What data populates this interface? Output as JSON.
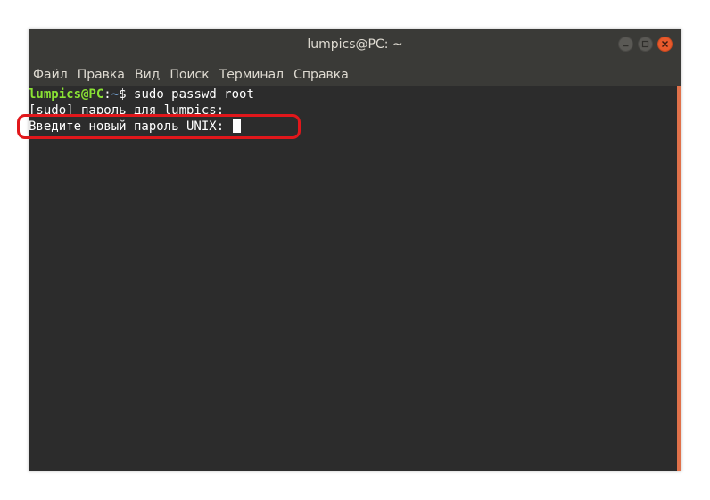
{
  "window": {
    "title": "lumpics@PC: ~"
  },
  "menu": {
    "items": [
      "Файл",
      "Правка",
      "Вид",
      "Поиск",
      "Терминал",
      "Справка"
    ]
  },
  "terminal": {
    "prompt_user": "lumpics@PC",
    "prompt_sep": ":",
    "prompt_path": "~",
    "prompt_symbol": "$ ",
    "command": "sudo passwd root",
    "line2": "[sudo] пароль для lumpics:",
    "line3": "Введите новый пароль UNIX: "
  },
  "colors": {
    "prompt_user": "#8ae234",
    "prompt_path": "#729fcf",
    "highlight": "#e1171b",
    "close_button": "#e85a2c",
    "background": "#2c2c2c"
  }
}
